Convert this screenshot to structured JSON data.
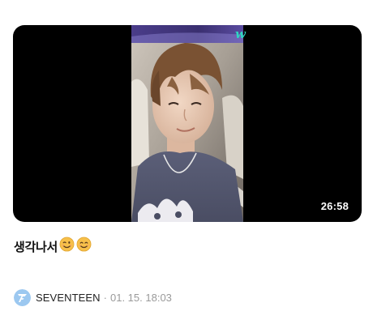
{
  "video": {
    "duration": "26:58",
    "brand_mark": "w"
  },
  "post": {
    "caption": "생각나서",
    "emojis": [
      "winking-face-emoji",
      "smiling-face-emoji"
    ]
  },
  "author": {
    "name": "SEVENTEEN",
    "separator": "·",
    "timestamp": "01. 15. 18:03"
  },
  "colors": {
    "brand_accent": "#2fd6c2",
    "avatar_bg": "#9cc8f0",
    "muted_text": "#9a9a9a"
  }
}
